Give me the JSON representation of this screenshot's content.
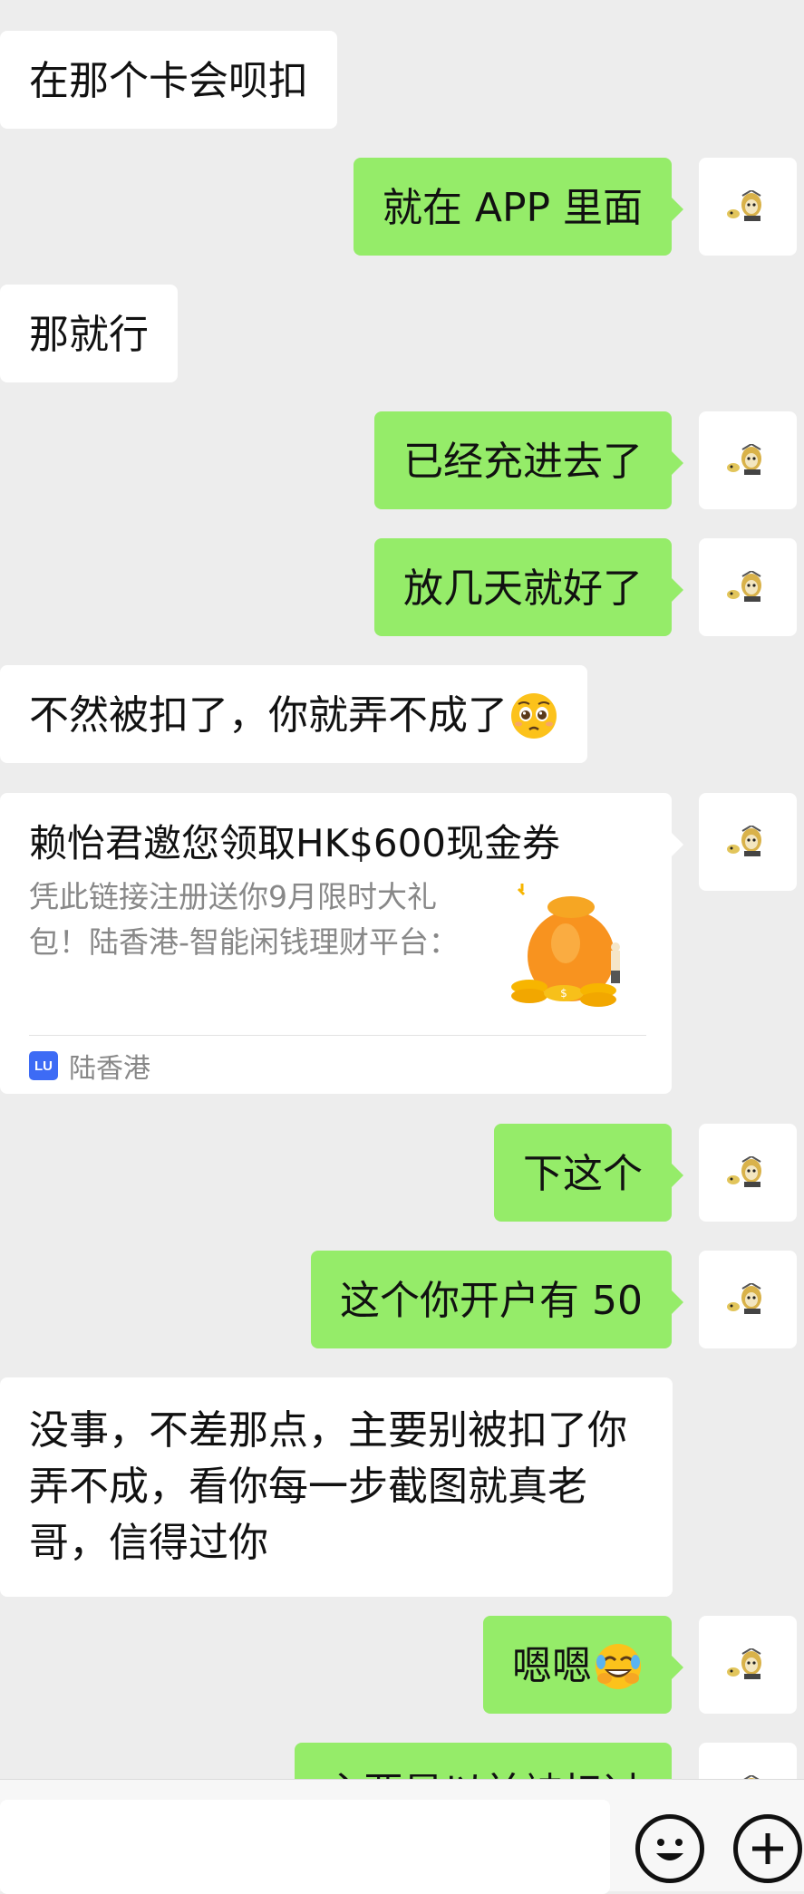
{
  "messages": [
    {
      "side": "in",
      "text": "在那个卡会呗扣"
    },
    {
      "side": "out",
      "text": "就在 APP 里面"
    },
    {
      "side": "in",
      "text": "那就行"
    },
    {
      "side": "out",
      "text": "已经充进去了"
    },
    {
      "side": "out",
      "text": "放几天就好了"
    },
    {
      "side": "in",
      "text": "不然被扣了，你就弄不成了",
      "emoji": "pleading-face-emoji"
    },
    {
      "side": "out",
      "text": "下这个"
    },
    {
      "side": "out",
      "text": "这个你开户有 50"
    },
    {
      "side": "in",
      "text": "没事，不差那点，主要别被扣了你弄不成，看你每一步截图就真老哥，信得过你"
    },
    {
      "side": "out",
      "text": "嗯嗯",
      "emoji": "rolling-laughing-emoji"
    },
    {
      "side": "out",
      "text": "主要是以前被扣过"
    }
  ],
  "link_card": {
    "title": "赖怡君邀您领取HK$600现金券",
    "description": "凭此链接注册送你9月限时大礼包！陆香港-智能闲钱理财平台：",
    "source_icon_text": "LU",
    "source_name": "陆香港"
  },
  "input_bar": {
    "emoji_icon": "smiley-icon",
    "more_icon": "plus-icon"
  },
  "colors": {
    "background": "#ededed",
    "outgoing_bubble": "#95ec69",
    "incoming_bubble": "#ffffff",
    "source_icon": "#3d6bf5"
  }
}
